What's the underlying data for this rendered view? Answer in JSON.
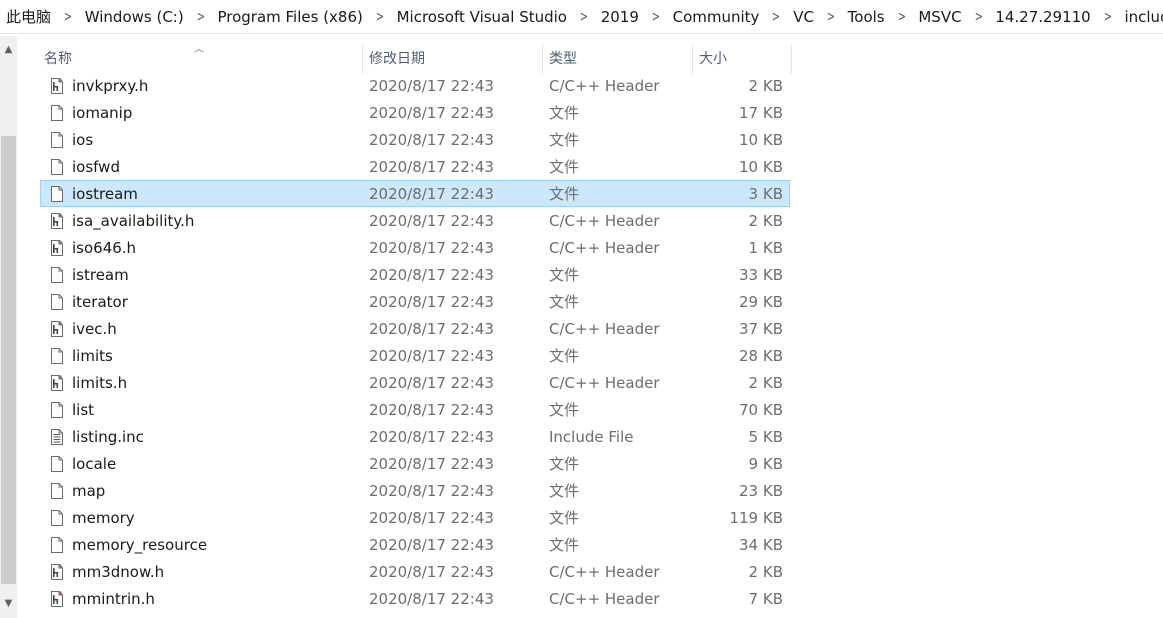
{
  "breadcrumb": [
    "此电脑",
    "Windows (C:)",
    "Program Files (x86)",
    "Microsoft Visual Studio",
    "2019",
    "Community",
    "VC",
    "Tools",
    "MSVC",
    "14.27.29110",
    "include"
  ],
  "columns": {
    "name": "名称",
    "date": "修改日期",
    "type": "类型",
    "size": "大小"
  },
  "sort": {
    "column": "name",
    "direction": "ascending"
  },
  "colors": {
    "selection_bg": "#cce8ff",
    "selection_border": "#99d1ff",
    "header_text": "#4c607a",
    "muted_text": "#6d6d6d"
  },
  "files": [
    {
      "name": "invkprxy.h",
      "date": "2020/8/17 22:43",
      "type": "C/C++ Header",
      "size": "2 KB",
      "icon": "cpp-header-icon"
    },
    {
      "name": "iomanip",
      "date": "2020/8/17 22:43",
      "type": "文件",
      "size": "17 KB",
      "icon": "file-icon"
    },
    {
      "name": "ios",
      "date": "2020/8/17 22:43",
      "type": "文件",
      "size": "10 KB",
      "icon": "file-icon"
    },
    {
      "name": "iosfwd",
      "date": "2020/8/17 22:43",
      "type": "文件",
      "size": "10 KB",
      "icon": "file-icon"
    },
    {
      "name": "iostream",
      "date": "2020/8/17 22:43",
      "type": "文件",
      "size": "3 KB",
      "icon": "file-icon",
      "selected": true
    },
    {
      "name": "isa_availability.h",
      "date": "2020/8/17 22:43",
      "type": "C/C++ Header",
      "size": "2 KB",
      "icon": "cpp-header-icon"
    },
    {
      "name": "iso646.h",
      "date": "2020/8/17 22:43",
      "type": "C/C++ Header",
      "size": "1 KB",
      "icon": "cpp-header-icon"
    },
    {
      "name": "istream",
      "date": "2020/8/17 22:43",
      "type": "文件",
      "size": "33 KB",
      "icon": "file-icon"
    },
    {
      "name": "iterator",
      "date": "2020/8/17 22:43",
      "type": "文件",
      "size": "29 KB",
      "icon": "file-icon"
    },
    {
      "name": "ivec.h",
      "date": "2020/8/17 22:43",
      "type": "C/C++ Header",
      "size": "37 KB",
      "icon": "cpp-header-icon"
    },
    {
      "name": "limits",
      "date": "2020/8/17 22:43",
      "type": "文件",
      "size": "28 KB",
      "icon": "file-icon"
    },
    {
      "name": "limits.h",
      "date": "2020/8/17 22:43",
      "type": "C/C++ Header",
      "size": "2 KB",
      "icon": "cpp-header-icon"
    },
    {
      "name": "list",
      "date": "2020/8/17 22:43",
      "type": "文件",
      "size": "70 KB",
      "icon": "file-icon"
    },
    {
      "name": "listing.inc",
      "date": "2020/8/17 22:43",
      "type": "Include File",
      "size": "5 KB",
      "icon": "text-file-icon"
    },
    {
      "name": "locale",
      "date": "2020/8/17 22:43",
      "type": "文件",
      "size": "9 KB",
      "icon": "file-icon"
    },
    {
      "name": "map",
      "date": "2020/8/17 22:43",
      "type": "文件",
      "size": "23 KB",
      "icon": "file-icon"
    },
    {
      "name": "memory",
      "date": "2020/8/17 22:43",
      "type": "文件",
      "size": "119 KB",
      "icon": "file-icon"
    },
    {
      "name": "memory_resource",
      "date": "2020/8/17 22:43",
      "type": "文件",
      "size": "34 KB",
      "icon": "file-icon"
    },
    {
      "name": "mm3dnow.h",
      "date": "2020/8/17 22:43",
      "type": "C/C++ Header",
      "size": "2 KB",
      "icon": "cpp-header-icon"
    },
    {
      "name": "mmintrin.h",
      "date": "2020/8/17 22:43",
      "type": "C/C++ Header",
      "size": "7 KB",
      "icon": "cpp-header-icon"
    }
  ]
}
